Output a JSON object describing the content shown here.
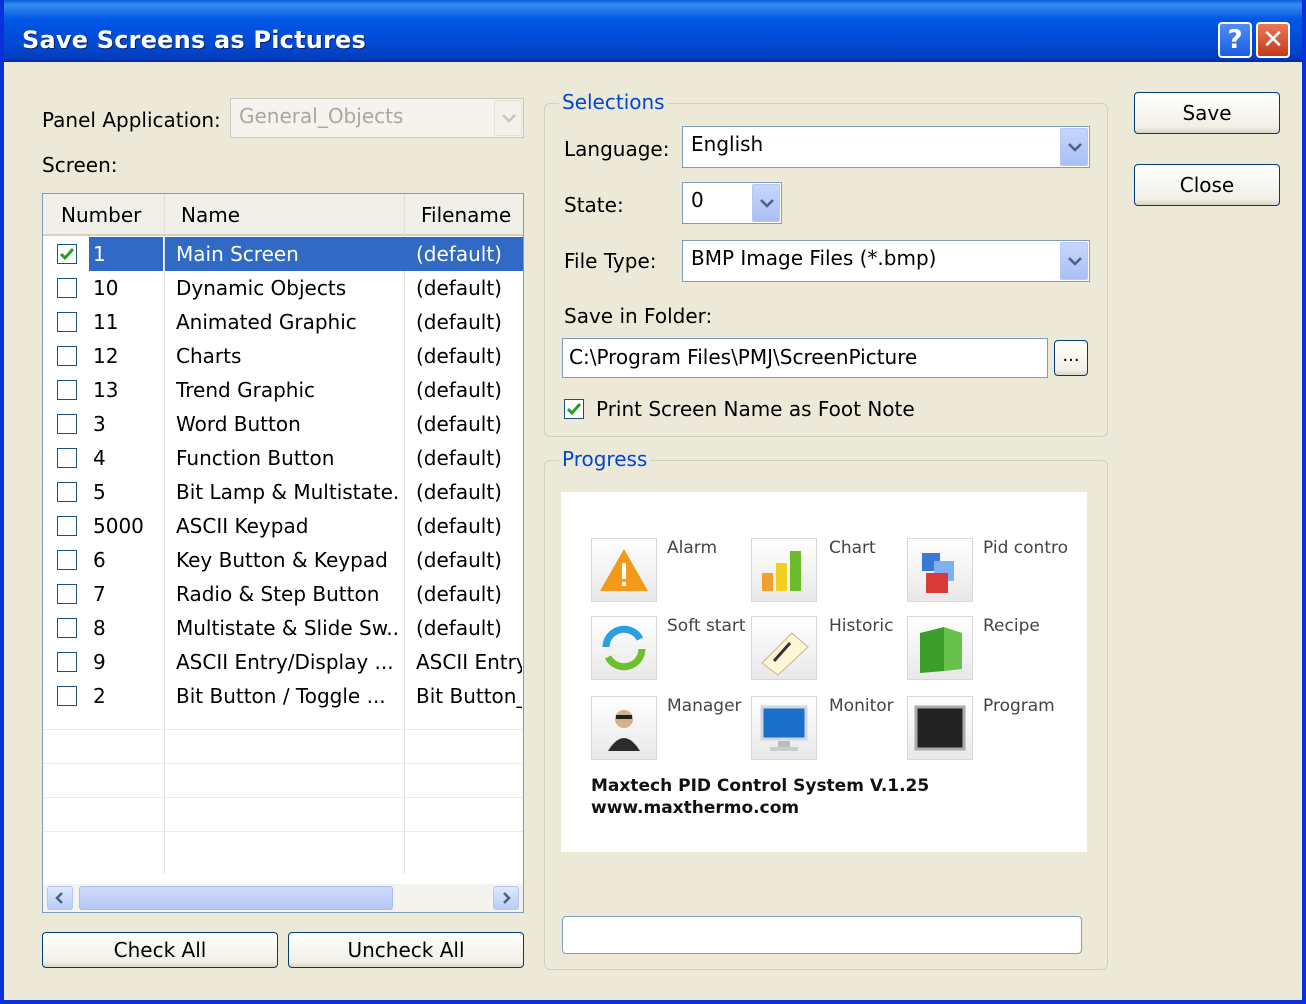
{
  "window": {
    "title": "Save Screens as Pictures",
    "help_glyph": "?",
    "close_glyph": "✕"
  },
  "left": {
    "panel_application_label": "Panel Application:",
    "panel_application_value": "General_Objects",
    "screen_label": "Screen:",
    "columns": [
      "Number",
      "Name",
      "Filename"
    ],
    "rows": [
      {
        "number": "1",
        "name": "Main Screen",
        "filename": "(default)",
        "checked": true,
        "selected": true
      },
      {
        "number": "10",
        "name": "Dynamic Objects",
        "filename": "(default)",
        "checked": false
      },
      {
        "number": "11",
        "name": "Animated Graphic",
        "filename": "(default)",
        "checked": false
      },
      {
        "number": "12",
        "name": "Charts",
        "filename": "(default)",
        "checked": false
      },
      {
        "number": "13",
        "name": "Trend Graphic",
        "filename": "(default)",
        "checked": false
      },
      {
        "number": "3",
        "name": "Word Button",
        "filename": "(default)",
        "checked": false
      },
      {
        "number": "4",
        "name": "Function Button",
        "filename": "(default)",
        "checked": false
      },
      {
        "number": "5",
        "name": "Bit Lamp & Multistate...",
        "filename": "(default)",
        "checked": false
      },
      {
        "number": "5000",
        "name": "ASCII Keypad",
        "filename": "(default)",
        "checked": false
      },
      {
        "number": "6",
        "name": "Key Button & Keypad",
        "filename": "(default)",
        "checked": false
      },
      {
        "number": "7",
        "name": "Radio & Step Button",
        "filename": "(default)",
        "checked": false
      },
      {
        "number": "8",
        "name": "Multistate & Slide Sw...",
        "filename": "(default)",
        "checked": false
      },
      {
        "number": "9",
        "name": "ASCII Entry/Display ...",
        "filename": "ASCII Entry",
        "checked": false
      },
      {
        "number": "2",
        "name": "Bit Button / Toggle ...",
        "filename": "Bit Button_",
        "checked": false
      }
    ],
    "scroll_left": "<",
    "scroll_right": ">",
    "check_all_label": "Check All",
    "uncheck_all_label": "Uncheck All"
  },
  "selections": {
    "group_title": "Selections",
    "language_label": "Language:",
    "language_value": "English",
    "state_label": "State:",
    "state_value": "0",
    "file_type_label": "File Type:",
    "file_type_value": "BMP Image Files (*.bmp)",
    "save_folder_label": "Save in Folder:",
    "save_folder_value": "C:\\Program Files\\PMJ\\ScreenPicture",
    "browse_label": "...",
    "print_name_label": "Print Screen Name as Foot Note",
    "print_name_checked": true
  },
  "progress": {
    "group_title": "Progress",
    "tiles": [
      {
        "label": "Alarm",
        "icon": "alarm-warning-icon"
      },
      {
        "label": "Chart",
        "icon": "bar-chart-icon"
      },
      {
        "label": "Pid contro",
        "icon": "pid-blocks-icon"
      },
      {
        "label": "Soft start",
        "icon": "refresh-cycle-icon"
      },
      {
        "label": "Historic",
        "icon": "notepad-pen-icon"
      },
      {
        "label": "Recipe",
        "icon": "recipe-book-icon"
      },
      {
        "label": "Manager",
        "icon": "manager-person-icon"
      },
      {
        "label": "Monitor",
        "icon": "monitor-icon"
      },
      {
        "label": "Program",
        "icon": "program-screen-icon"
      }
    ],
    "brand_line1": "Maxtech PID Control System V.1.25",
    "brand_line2": "www.maxthermo.com",
    "progress_value": 0
  },
  "actions": {
    "save_label": "Save",
    "close_label": "Close"
  }
}
